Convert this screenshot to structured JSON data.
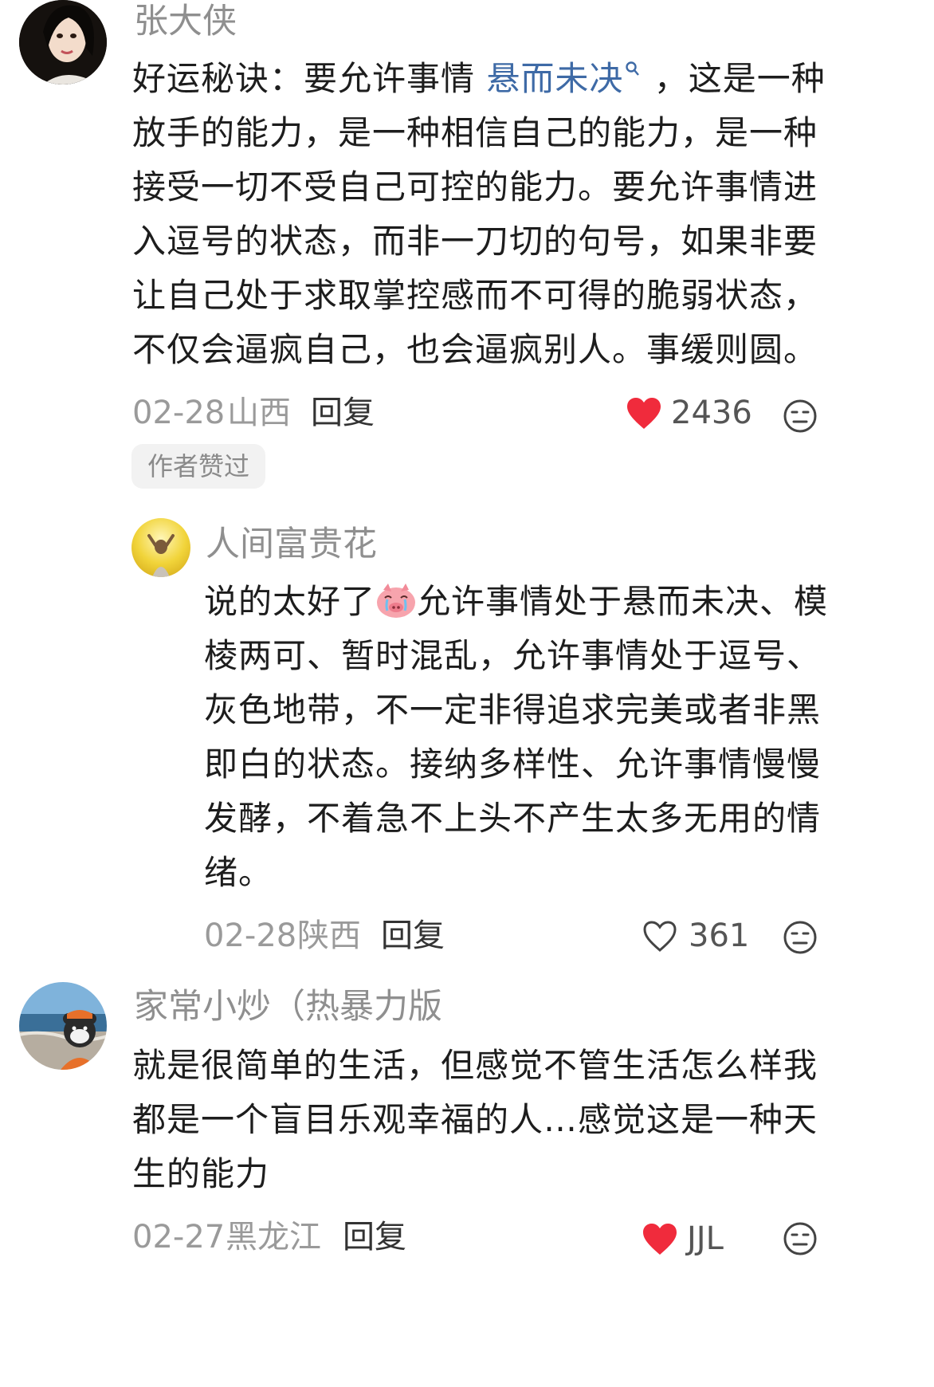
{
  "comments": [
    {
      "username": "张大侠",
      "lines_pre": "好运秘诀：要允许事情 ",
      "link": "悬而未决",
      "link_icon": "search-icon",
      "lines_post": " ，这是一种",
      "lines": [
        "放手的能力，是一种相信自己的能力，是一种",
        "接受一切不受自己可控的能力。要允许事情进",
        "入逗号的状态，而非一刀切的句号，如果非要",
        "让自己处于求取掌控感而不可得的脆弱状态，",
        "不仅会逼疯自己，也会逼疯别人。事缓则圆。"
      ],
      "date": "02-28",
      "location": "山西",
      "reply": "回复",
      "likes": "2436",
      "liked": true,
      "badge": "作者赞过"
    },
    {
      "username": "人间富贵花",
      "first_pre": "说的太好了",
      "emoji": "crying-pig-emoji",
      "first_post": "允许事情处于悬而未决、模",
      "lines": [
        "棱两可、暂时混乱，允许事情处于逗号、",
        "灰色地带，不一定非得追求完美或者非黑",
        "即白的状态。接纳多样性、允许事情慢慢",
        "发酵，不着急不上头不产生太多无用的情",
        "绪。"
      ],
      "date": "02-28",
      "location": "陕西",
      "reply": "回复",
      "likes": "361",
      "liked": false
    },
    {
      "username": "家常小炒（热暴力版",
      "lines": [
        "就是很简单的生活，但感觉不管生活怎么样我",
        "都是一个盲目乐观幸福的人…感觉这是一种天",
        "生的能力"
      ],
      "date": "02-27",
      "location": "黑龙江",
      "reply": "回复",
      "likes": "JJL",
      "liked": true
    }
  ],
  "colors": {
    "heart_red": "#f02b3c",
    "link_blue": "#3e6aa6"
  }
}
